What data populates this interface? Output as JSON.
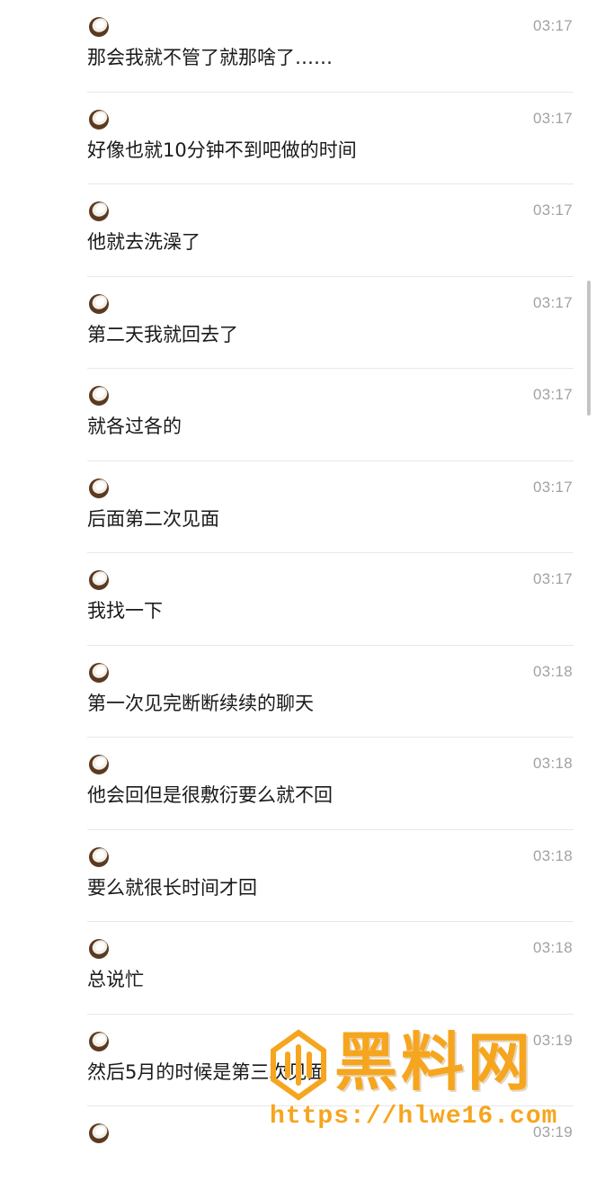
{
  "messages": [
    {
      "time": "03:17",
      "text": "那会我就不管了就那啥了……"
    },
    {
      "time": "03:17",
      "text": "好像也就10分钟不到吧做的时间"
    },
    {
      "time": "03:17",
      "text": "他就去洗澡了"
    },
    {
      "time": "03:17",
      "text": "第二天我就回去了"
    },
    {
      "time": "03:17",
      "text": "就各过各的"
    },
    {
      "time": "03:17",
      "text": "后面第二次见面"
    },
    {
      "time": "03:17",
      "text": "我找一下"
    },
    {
      "time": "03:18",
      "text": "第一次见完断断续续的聊天"
    },
    {
      "time": "03:18",
      "text": "他会回但是很敷衍要么就不回"
    },
    {
      "time": "03:18",
      "text": "要么就很长时间才回"
    },
    {
      "time": "03:18",
      "text": "总说忙"
    },
    {
      "time": "03:19",
      "text": "然后5月的时候是第三次见面"
    },
    {
      "time": "03:19",
      "text": ""
    }
  ],
  "avatar_icon": "coconut-avatar-icon",
  "watermark": {
    "title": "黑料网",
    "url": "https://hlwe16.com",
    "color": "#f6a51e"
  }
}
